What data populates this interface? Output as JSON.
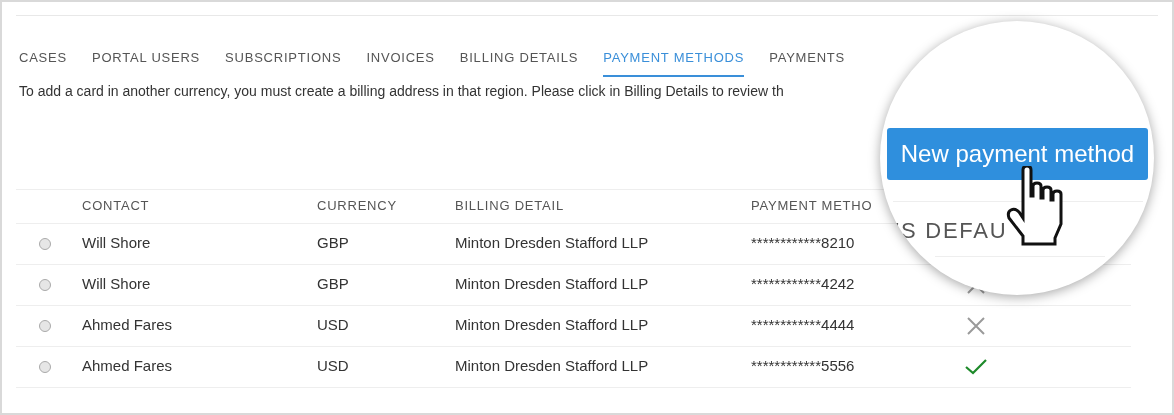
{
  "tabs": [
    {
      "label": "CASES",
      "selected": false
    },
    {
      "label": "PORTAL USERS",
      "selected": false
    },
    {
      "label": "SUBSCRIPTIONS",
      "selected": false
    },
    {
      "label": "INVOICES",
      "selected": false
    },
    {
      "label": "BILLING DETAILS",
      "selected": false
    },
    {
      "label": "PAYMENT METHODS",
      "selected": true
    },
    {
      "label": "PAYMENTS",
      "selected": false
    }
  ],
  "notice": "To add a card in another currency, you must create a billing address in that region. Please click in Billing Details to review th",
  "table": {
    "columns": [
      "CONTACT",
      "CURRENCY",
      "BILLING DETAIL",
      "PAYMENT METHO"
    ],
    "rows": [
      {
        "selected": false,
        "contact": "Will Shore",
        "currency": "GBP",
        "billing_detail": "Minton Dresden Stafford LLP",
        "payment_method": "************8210"
      },
      {
        "selected": false,
        "contact": "Will Shore",
        "currency": "GBP",
        "billing_detail": "Minton Dresden Stafford LLP",
        "payment_method": "************4242",
        "is_default": false
      },
      {
        "selected": false,
        "contact": "Ahmed Fares",
        "currency": "USD",
        "billing_detail": "Minton Dresden Stafford LLP",
        "payment_method": "************4444",
        "is_default": false
      },
      {
        "selected": false,
        "contact": "Ahmed Fares",
        "currency": "USD",
        "billing_detail": "Minton Dresden Stafford LLP",
        "payment_method": "************5556",
        "is_default": true
      }
    ]
  },
  "magnifier": {
    "button": "New payment method",
    "column_heading": "'S DEFAU"
  }
}
